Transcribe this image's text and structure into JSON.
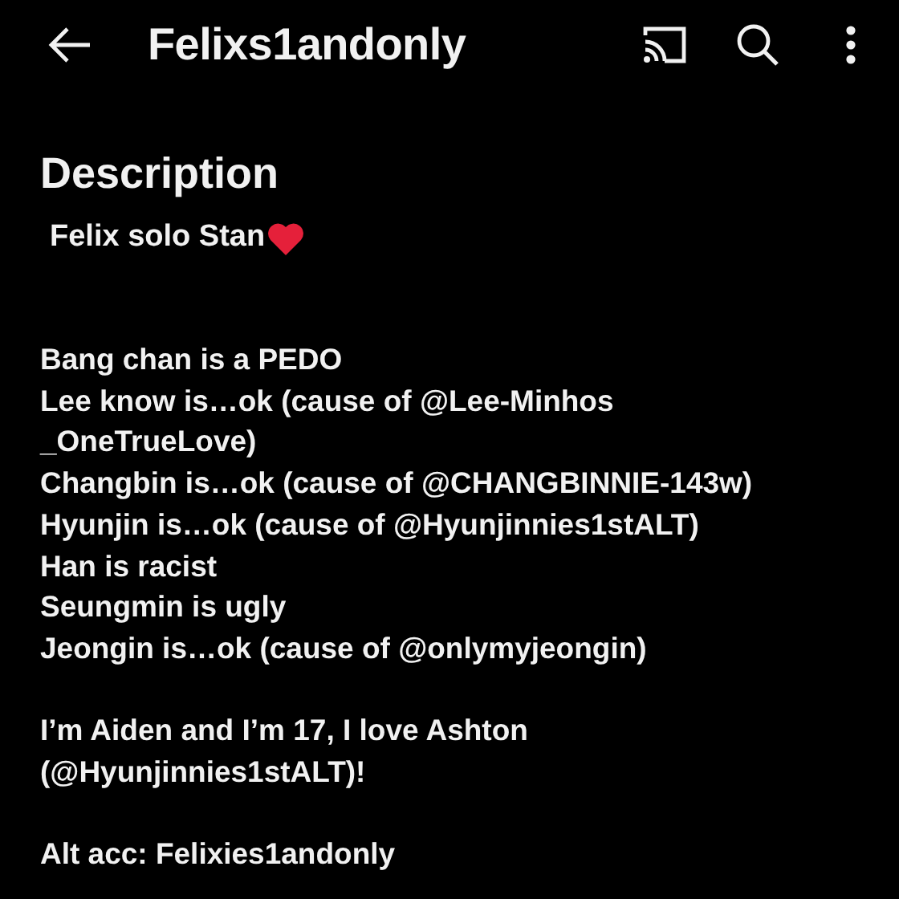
{
  "header": {
    "title": "Felixs1andonly"
  },
  "description": {
    "heading": "Description",
    "tagline": "Felix solo Stan",
    "blocks": [
      [
        "Bang chan is a PEDO",
        "Lee know is…ok (cause of @Lee-Minhos _OneTrueLove)",
        "Changbin is…ok (cause of @CHANGBINNIE-143w)",
        "Hyunjin is…ok (cause of @Hyunjinnies1stALT)",
        "Han is racist",
        "Seungmin is ugly",
        "Jeongin is…ok (cause of @onlymyjeongin)"
      ],
      [
        "I’m Aiden and I’m 17, I love Ashton (@Hyunjinnies1stALT)!"
      ],
      [
        "Alt acc: Felixies1andonly"
      ]
    ]
  }
}
